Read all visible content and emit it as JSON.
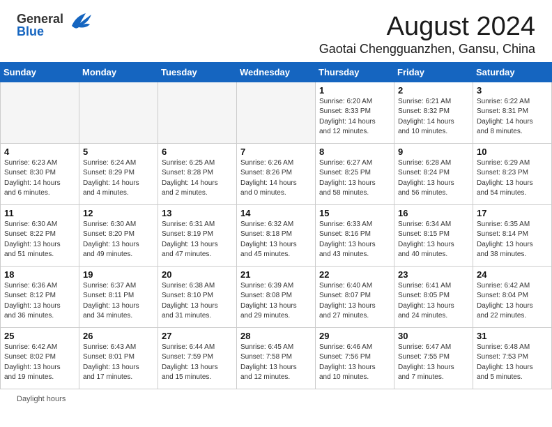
{
  "header": {
    "logo_line1": "General",
    "logo_line2": "Blue",
    "month": "August 2024",
    "location": "Gaotai Chengguanzhen, Gansu, China"
  },
  "weekdays": [
    "Sunday",
    "Monday",
    "Tuesday",
    "Wednesday",
    "Thursday",
    "Friday",
    "Saturday"
  ],
  "weeks": [
    [
      {
        "day": "",
        "info": ""
      },
      {
        "day": "",
        "info": ""
      },
      {
        "day": "",
        "info": ""
      },
      {
        "day": "",
        "info": ""
      },
      {
        "day": "1",
        "info": "Sunrise: 6:20 AM\nSunset: 8:33 PM\nDaylight: 14 hours\nand 12 minutes."
      },
      {
        "day": "2",
        "info": "Sunrise: 6:21 AM\nSunset: 8:32 PM\nDaylight: 14 hours\nand 10 minutes."
      },
      {
        "day": "3",
        "info": "Sunrise: 6:22 AM\nSunset: 8:31 PM\nDaylight: 14 hours\nand 8 minutes."
      }
    ],
    [
      {
        "day": "4",
        "info": "Sunrise: 6:23 AM\nSunset: 8:30 PM\nDaylight: 14 hours\nand 6 minutes."
      },
      {
        "day": "5",
        "info": "Sunrise: 6:24 AM\nSunset: 8:29 PM\nDaylight: 14 hours\nand 4 minutes."
      },
      {
        "day": "6",
        "info": "Sunrise: 6:25 AM\nSunset: 8:28 PM\nDaylight: 14 hours\nand 2 minutes."
      },
      {
        "day": "7",
        "info": "Sunrise: 6:26 AM\nSunset: 8:26 PM\nDaylight: 14 hours\nand 0 minutes."
      },
      {
        "day": "8",
        "info": "Sunrise: 6:27 AM\nSunset: 8:25 PM\nDaylight: 13 hours\nand 58 minutes."
      },
      {
        "day": "9",
        "info": "Sunrise: 6:28 AM\nSunset: 8:24 PM\nDaylight: 13 hours\nand 56 minutes."
      },
      {
        "day": "10",
        "info": "Sunrise: 6:29 AM\nSunset: 8:23 PM\nDaylight: 13 hours\nand 54 minutes."
      }
    ],
    [
      {
        "day": "11",
        "info": "Sunrise: 6:30 AM\nSunset: 8:22 PM\nDaylight: 13 hours\nand 51 minutes."
      },
      {
        "day": "12",
        "info": "Sunrise: 6:30 AM\nSunset: 8:20 PM\nDaylight: 13 hours\nand 49 minutes."
      },
      {
        "day": "13",
        "info": "Sunrise: 6:31 AM\nSunset: 8:19 PM\nDaylight: 13 hours\nand 47 minutes."
      },
      {
        "day": "14",
        "info": "Sunrise: 6:32 AM\nSunset: 8:18 PM\nDaylight: 13 hours\nand 45 minutes."
      },
      {
        "day": "15",
        "info": "Sunrise: 6:33 AM\nSunset: 8:16 PM\nDaylight: 13 hours\nand 43 minutes."
      },
      {
        "day": "16",
        "info": "Sunrise: 6:34 AM\nSunset: 8:15 PM\nDaylight: 13 hours\nand 40 minutes."
      },
      {
        "day": "17",
        "info": "Sunrise: 6:35 AM\nSunset: 8:14 PM\nDaylight: 13 hours\nand 38 minutes."
      }
    ],
    [
      {
        "day": "18",
        "info": "Sunrise: 6:36 AM\nSunset: 8:12 PM\nDaylight: 13 hours\nand 36 minutes."
      },
      {
        "day": "19",
        "info": "Sunrise: 6:37 AM\nSunset: 8:11 PM\nDaylight: 13 hours\nand 34 minutes."
      },
      {
        "day": "20",
        "info": "Sunrise: 6:38 AM\nSunset: 8:10 PM\nDaylight: 13 hours\nand 31 minutes."
      },
      {
        "day": "21",
        "info": "Sunrise: 6:39 AM\nSunset: 8:08 PM\nDaylight: 13 hours\nand 29 minutes."
      },
      {
        "day": "22",
        "info": "Sunrise: 6:40 AM\nSunset: 8:07 PM\nDaylight: 13 hours\nand 27 minutes."
      },
      {
        "day": "23",
        "info": "Sunrise: 6:41 AM\nSunset: 8:05 PM\nDaylight: 13 hours\nand 24 minutes."
      },
      {
        "day": "24",
        "info": "Sunrise: 6:42 AM\nSunset: 8:04 PM\nDaylight: 13 hours\nand 22 minutes."
      }
    ],
    [
      {
        "day": "25",
        "info": "Sunrise: 6:42 AM\nSunset: 8:02 PM\nDaylight: 13 hours\nand 19 minutes."
      },
      {
        "day": "26",
        "info": "Sunrise: 6:43 AM\nSunset: 8:01 PM\nDaylight: 13 hours\nand 17 minutes."
      },
      {
        "day": "27",
        "info": "Sunrise: 6:44 AM\nSunset: 7:59 PM\nDaylight: 13 hours\nand 15 minutes."
      },
      {
        "day": "28",
        "info": "Sunrise: 6:45 AM\nSunset: 7:58 PM\nDaylight: 13 hours\nand 12 minutes."
      },
      {
        "day": "29",
        "info": "Sunrise: 6:46 AM\nSunset: 7:56 PM\nDaylight: 13 hours\nand 10 minutes."
      },
      {
        "day": "30",
        "info": "Sunrise: 6:47 AM\nSunset: 7:55 PM\nDaylight: 13 hours\nand 7 minutes."
      },
      {
        "day": "31",
        "info": "Sunrise: 6:48 AM\nSunset: 7:53 PM\nDaylight: 13 hours\nand 5 minutes."
      }
    ]
  ],
  "footer": {
    "label": "Daylight hours"
  }
}
